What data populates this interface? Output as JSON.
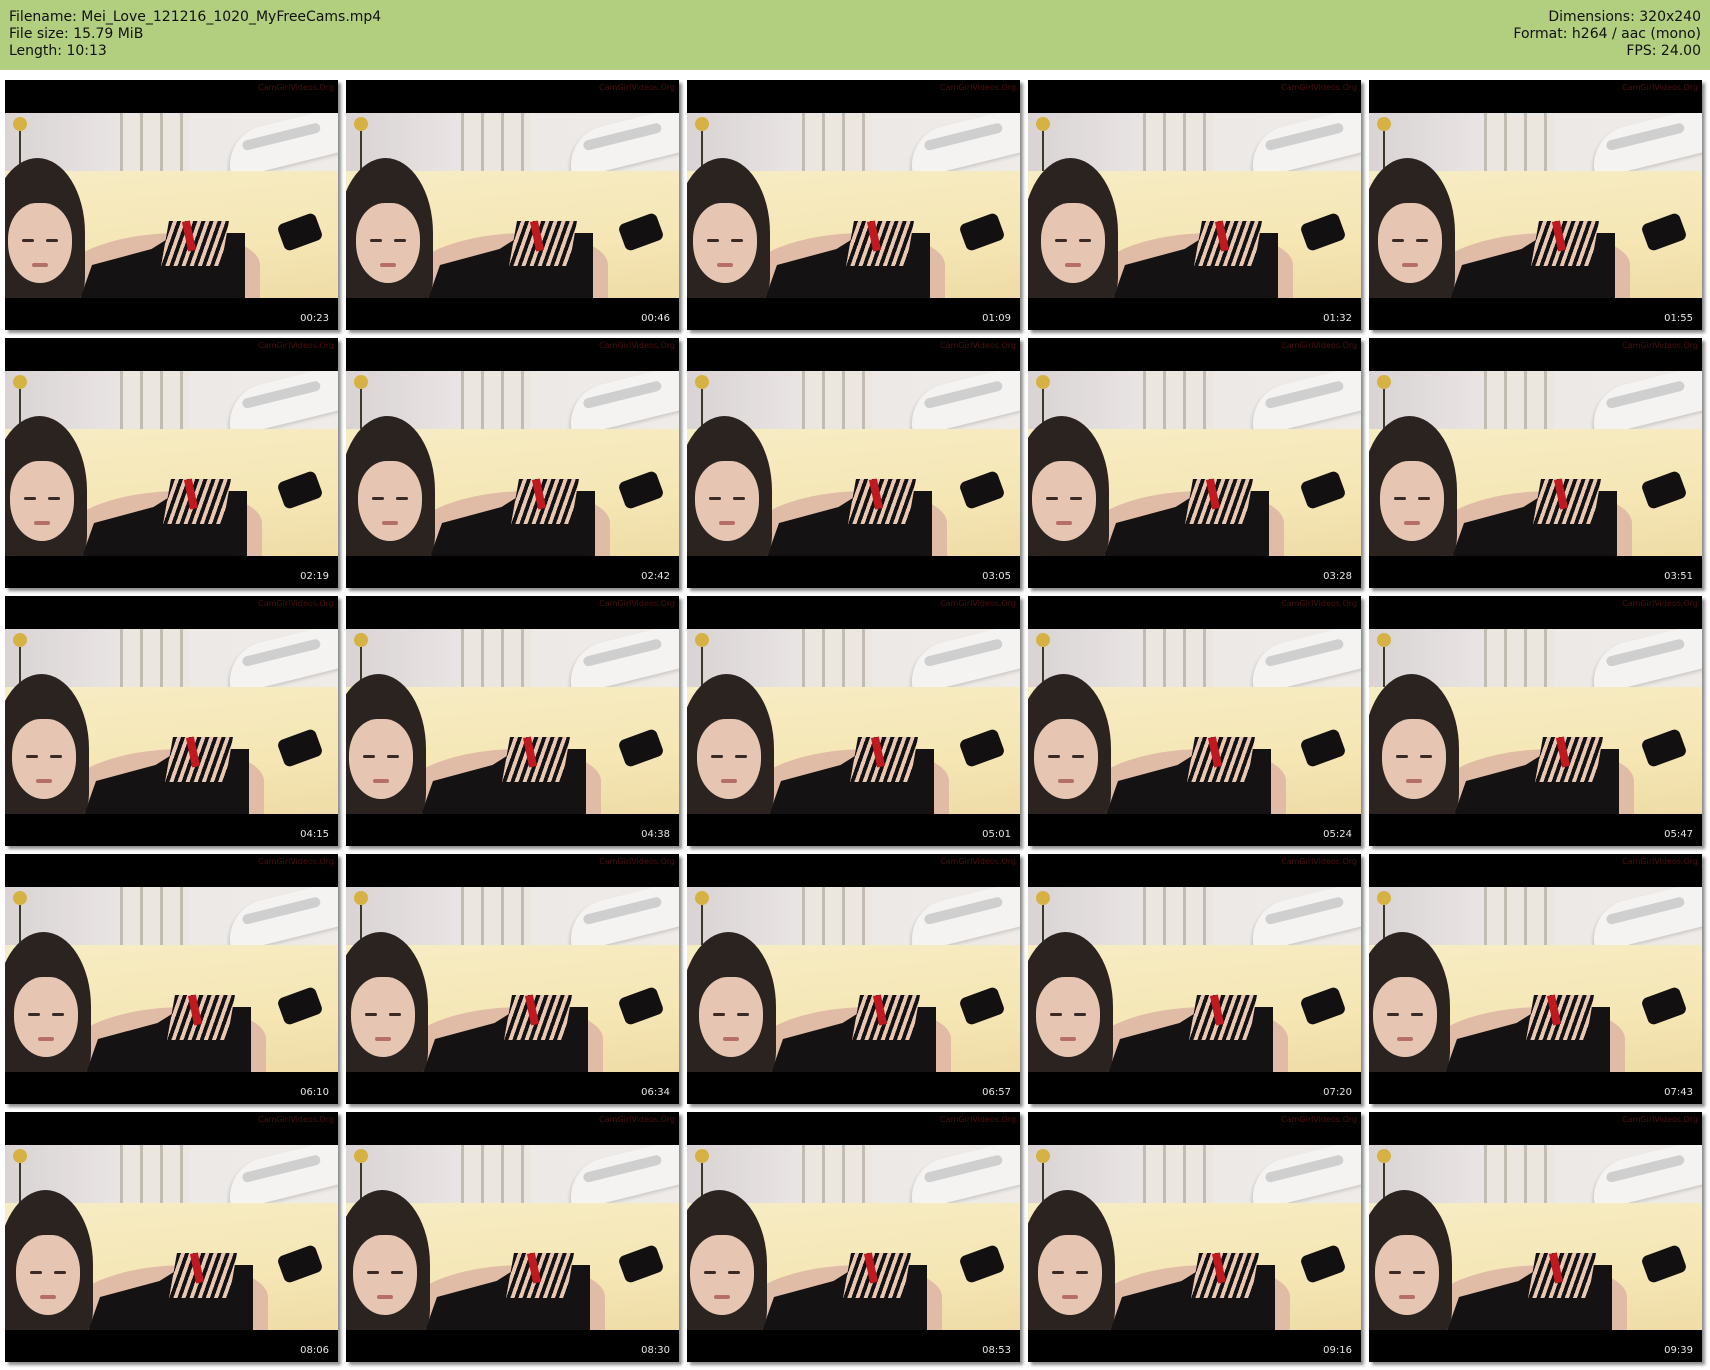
{
  "header": {
    "filename_line": "Filename: Mei_Love_121216_1020_MyFreeCams.mp4",
    "filesize_line": "File size: 15.79 MiB",
    "length_line": "Length: 10:13",
    "dimensions_line": "Dimensions: 320x240",
    "format_line": "Format: h264 / aac (mono)",
    "fps_line": "FPS: 24.00",
    "background_color": "#b2ce7f"
  },
  "thumbnails": [
    {
      "timestamp": "00:23"
    },
    {
      "timestamp": "00:46"
    },
    {
      "timestamp": "01:09"
    },
    {
      "timestamp": "01:32"
    },
    {
      "timestamp": "01:55"
    },
    {
      "timestamp": "02:19"
    },
    {
      "timestamp": "02:42"
    },
    {
      "timestamp": "03:05"
    },
    {
      "timestamp": "03:28"
    },
    {
      "timestamp": "03:51"
    },
    {
      "timestamp": "04:15"
    },
    {
      "timestamp": "04:38"
    },
    {
      "timestamp": "05:01"
    },
    {
      "timestamp": "05:24"
    },
    {
      "timestamp": "05:47"
    },
    {
      "timestamp": "06:10"
    },
    {
      "timestamp": "06:34"
    },
    {
      "timestamp": "06:57"
    },
    {
      "timestamp": "07:20"
    },
    {
      "timestamp": "07:43"
    },
    {
      "timestamp": "08:06"
    },
    {
      "timestamp": "08:30"
    },
    {
      "timestamp": "08:53"
    },
    {
      "timestamp": "09:16"
    },
    {
      "timestamp": "09:39"
    }
  ],
  "watermark_text": "CamGirlVideos.Org"
}
